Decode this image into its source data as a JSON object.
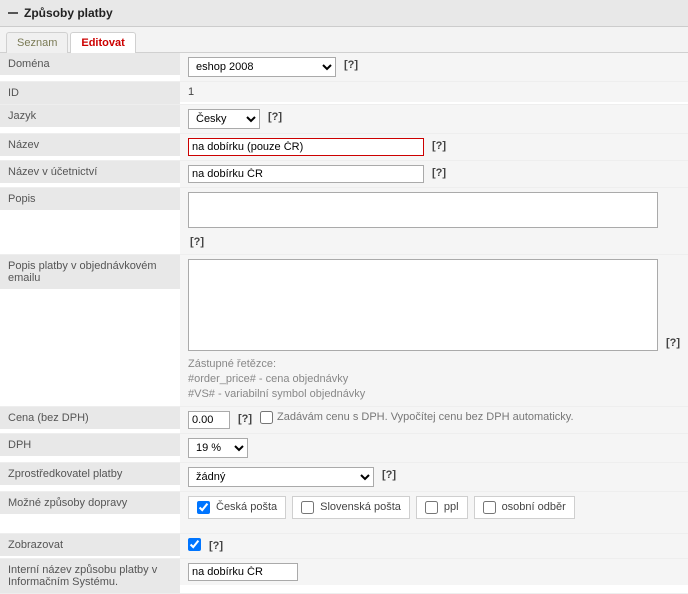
{
  "header": {
    "title": "Způsoby platby"
  },
  "tabs": {
    "list": "Seznam",
    "edit": "Editovat"
  },
  "labels": {
    "domain": "Doména",
    "id": "ID",
    "lang": "Jazyk",
    "name": "Název",
    "acct_name": "Název v účetnictví",
    "desc": "Popis",
    "email_desc": "Popis platby v objednávkovém emailu",
    "price": "Cena (bez DPH)",
    "vat": "DPH",
    "provider": "Zprostředkovatel platby",
    "delivery": "Možné způsoby dopravy",
    "show": "Zobrazovat",
    "internal": "Interní název způsobu platby v Informačním Systému."
  },
  "values": {
    "domain_selected": "eshop 2008",
    "id": "1",
    "lang_selected": "Česky",
    "name": "na dobírku (pouze ČR)",
    "acct_name": "na dobírku ČR",
    "desc": "",
    "email_desc": "",
    "price": "0.00",
    "vat_selected": "19 %",
    "provider_selected": "žádný",
    "internal": "na dobírku ČR"
  },
  "placeholders_note": {
    "heading": "Zástupné řetězce:",
    "l1": "#order_price# - cena objednávky",
    "l2": "#VS# - variabilní symbol objednávky"
  },
  "price_vat_checkbox_label": "Zadávám cenu s DPH. Vypočítej cenu bez DPH automaticky.",
  "delivery_options": {
    "cz_post": "Česká pošta",
    "sk_post": "Slovenská pošta",
    "ppl": "ppl",
    "pickup": "osobní odběr"
  },
  "help_text": "[?]"
}
